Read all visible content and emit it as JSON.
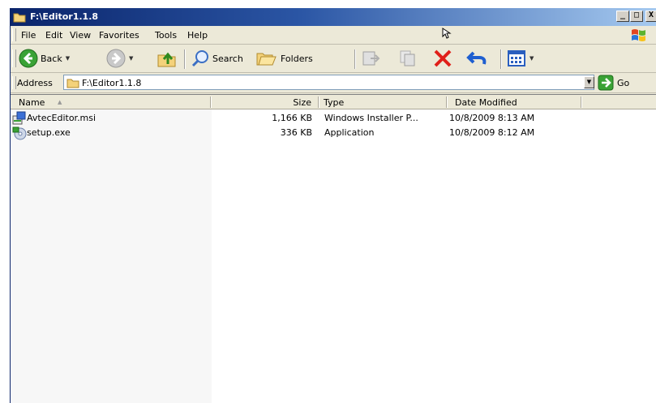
{
  "window": {
    "title": "F:\\Editor1.1.8"
  },
  "titlebar_buttons": {
    "minimize": "_",
    "maximize": "□",
    "close": "X"
  },
  "menu": [
    "File",
    "Edit",
    "View",
    "Favorites",
    "Tools",
    "Help"
  ],
  "toolbar": {
    "back_label": "Back",
    "search_label": "Search",
    "folders_label": "Folders",
    "dropdown_glyph": "▼"
  },
  "address": {
    "label": "Address",
    "value": "F:\\Editor1.1.8",
    "go_label": "Go"
  },
  "list": {
    "columns": [
      "Name",
      "Size",
      "Type",
      "Date Modified"
    ],
    "sort_glyph": "▲",
    "rows": [
      {
        "name": "AvtecEditor.msi",
        "size": "1,166 KB",
        "type": "Windows Installer P...",
        "date": "10/8/2009 8:13 AM",
        "icon": "msi-installer-icon"
      },
      {
        "name": "setup.exe",
        "size": "336 KB",
        "type": "Application",
        "date": "10/8/2009 8:12 AM",
        "icon": "setup-exe-icon"
      }
    ]
  },
  "colors": {
    "title_start": "#0a246a",
    "title_end": "#a6caf0",
    "chrome": "#ece9d8"
  }
}
